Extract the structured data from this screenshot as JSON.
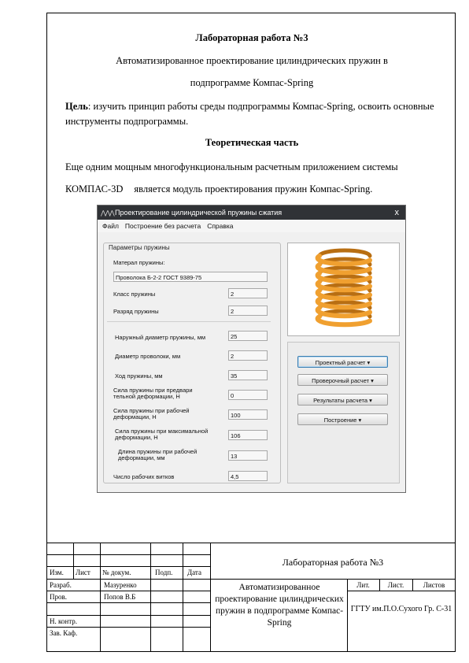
{
  "heading": {
    "title": "Лабораторная работа №3",
    "subtitle_line1": "Автоматизированное проектирование цилиндрических пружин в",
    "subtitle_line2": "подпрограмме Компас-Spring"
  },
  "goal": {
    "label": "Цель",
    "text": ": изучить принцип работы среды подпрограммы Компас-Spring, освоить основные инструменты подпрограммы."
  },
  "theory": {
    "heading": "Теоретическая часть",
    "line1": "Еще одним мощным многофункциональным расчетным приложением системы",
    "line2a": "КОМПАС-3D",
    "line2b": "является модуль проектирования пружин  Компас-Spring."
  },
  "window": {
    "title": "Проектирование цилиндрической пружины сжатия",
    "close": "x",
    "menu": [
      "Файл",
      "Построение без расчета",
      "Справка"
    ],
    "group_label": "Параметры пружины",
    "material_label": "Матерал пружины:",
    "material_value": "Проволока Б-2-2 ГОСТ 9389-75",
    "fields": [
      {
        "label": "Класс пружины",
        "value": "2"
      },
      {
        "label": "Разряд пружины",
        "value": "2"
      },
      {
        "label": "Наружный диаметр пружины, мм",
        "value": "25"
      },
      {
        "label": "Диаметр проволоки, мм",
        "value": "2"
      },
      {
        "label": "Ход пружины, мм",
        "value": "35"
      },
      {
        "label": "Сила пружины при предвари тельной деформации, Н",
        "value": "0"
      },
      {
        "label": "Сила пружины при рабочей деформации, Н",
        "value": "100"
      },
      {
        "label": "Сила пружины при максимальной деформации, Н",
        "value": "106"
      },
      {
        "label": "Длина пружины при рабочей деформации, мм",
        "value": "13"
      },
      {
        "label": "Число рабочих витков",
        "value": "4,5"
      }
    ],
    "buttons": [
      "Проектный расчет  ▾",
      "Проверочный расчет  ▾",
      "Результаты расчета  ▾",
      "Построение  ▾"
    ],
    "spring_color": "#f0a030"
  },
  "stamp": {
    "doc_title": "Лабораторная работа №3",
    "headers": {
      "izm": "Изм.",
      "list": "Лист",
      "doc_no": "№ докум.",
      "sign": "Подп.",
      "date": "Дата"
    },
    "rows": [
      {
        "role": "Разраб.",
        "name": "Мазуренко"
      },
      {
        "role": "Пров.",
        "name": "Попов В.Б"
      },
      {
        "role": "",
        "name": ""
      },
      {
        "role": "Н. контр.",
        "name": ""
      },
      {
        "role": "Зав. Каф.",
        "name": ""
      }
    ],
    "description": "Автоматизированное проектирование цилиндрических пружин в подпрограмме Компас-Spring",
    "lit": "Лит.",
    "sheet": "Лист.",
    "sheets": "Листов",
    "org": "ГГТУ им.П.О.Сухого Гр. С-31"
  }
}
